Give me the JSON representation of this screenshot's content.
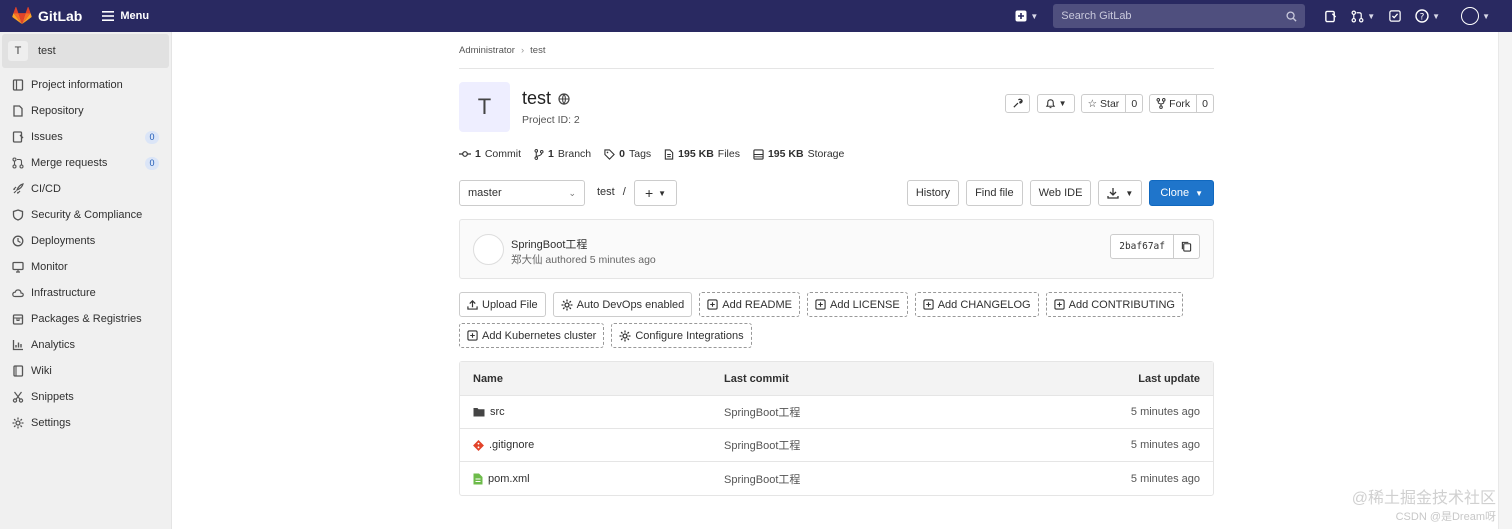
{
  "topbar": {
    "brand": "GitLab",
    "menu_label": "Menu",
    "search_placeholder": "Search GitLab"
  },
  "sidebar": {
    "project_avatar_letter": "T",
    "project_name": "test",
    "items": [
      {
        "label": "Project information",
        "icon": "info-icon"
      },
      {
        "label": "Repository",
        "icon": "doc-icon"
      },
      {
        "label": "Issues",
        "icon": "issues-icon",
        "badge": "0"
      },
      {
        "label": "Merge requests",
        "icon": "merge-icon",
        "badge": "0"
      },
      {
        "label": "CI/CD",
        "icon": "rocket-icon"
      },
      {
        "label": "Security & Compliance",
        "icon": "shield-icon"
      },
      {
        "label": "Deployments",
        "icon": "deploy-icon"
      },
      {
        "label": "Monitor",
        "icon": "monitor-icon"
      },
      {
        "label": "Infrastructure",
        "icon": "cloud-icon"
      },
      {
        "label": "Packages & Registries",
        "icon": "package-icon"
      },
      {
        "label": "Analytics",
        "icon": "chart-icon"
      },
      {
        "label": "Wiki",
        "icon": "book-icon"
      },
      {
        "label": "Snippets",
        "icon": "scissors-icon"
      },
      {
        "label": "Settings",
        "icon": "gear-icon"
      }
    ]
  },
  "breadcrumb": {
    "first": "Administrator",
    "second": "test"
  },
  "project": {
    "avatar_letter": "T",
    "name": "test",
    "id_text": "Project ID: 2",
    "star_label": "Star",
    "star_count": "0",
    "fork_label": "Fork",
    "fork_count": "0"
  },
  "stats": {
    "commits_num": "1",
    "commits_label": "Commit",
    "branches_num": "1",
    "branches_label": "Branch",
    "tags_num": "0",
    "tags_label": "Tags",
    "files_num": "195 KB",
    "files_label": "Files",
    "storage_num": "195 KB",
    "storage_label": "Storage"
  },
  "toolbar": {
    "branch": "master",
    "path": "test",
    "path_sep": "/",
    "history": "History",
    "find_file": "Find file",
    "web_ide": "Web IDE",
    "clone": "Clone"
  },
  "commit": {
    "title": "SpringBoot工程",
    "meta": "郑大仙 authored 5 minutes ago",
    "sha": "2baf67af"
  },
  "quick_actions": {
    "upload": "Upload File",
    "devops": "Auto DevOps enabled",
    "readme": "Add README",
    "license": "Add LICENSE",
    "changelog": "Add CHANGELOG",
    "contributing": "Add CONTRIBUTING",
    "kubernetes": "Add Kubernetes cluster",
    "integrations": "Configure Integrations"
  },
  "files": {
    "headers": {
      "name": "Name",
      "commit": "Last commit",
      "update": "Last update"
    },
    "rows": [
      {
        "name": "src",
        "commit": "SpringBoot工程",
        "update": "5 minutes ago",
        "icon": "folder-icon"
      },
      {
        "name": ".gitignore",
        "commit": "SpringBoot工程",
        "update": "5 minutes ago",
        "icon": "git-icon"
      },
      {
        "name": "pom.xml",
        "commit": "SpringBoot工程",
        "update": "5 minutes ago",
        "icon": "file-icon"
      }
    ]
  },
  "watermark": {
    "line1": "@稀土掘金技术社区",
    "line2": "CSDN @是Dream呀"
  },
  "colors": {
    "navbar": "#292961",
    "accent": "#1f75cb"
  }
}
